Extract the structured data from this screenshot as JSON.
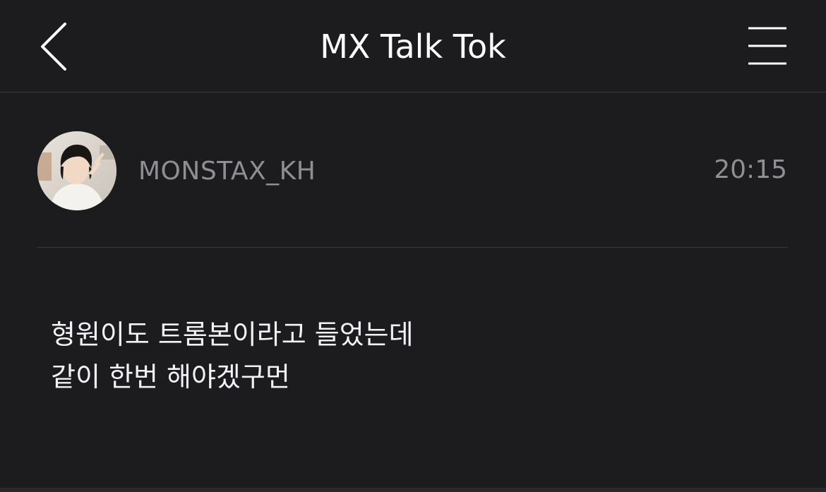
{
  "header": {
    "title": "MX Talk Tok",
    "back_icon": "chevron-left-icon",
    "menu_icon": "hamburger-menu-icon"
  },
  "post": {
    "username": "MONSTAX_KH",
    "time": "20:15",
    "message_lines": [
      "형원이도 트롬본이라고 들었는데",
      "같이 한번 해야겠구먼"
    ]
  },
  "colors": {
    "background": "#1c1c1e",
    "text_primary": "#ffffff",
    "text_secondary": "#8e8e93",
    "divider": "#3a3a3c"
  }
}
